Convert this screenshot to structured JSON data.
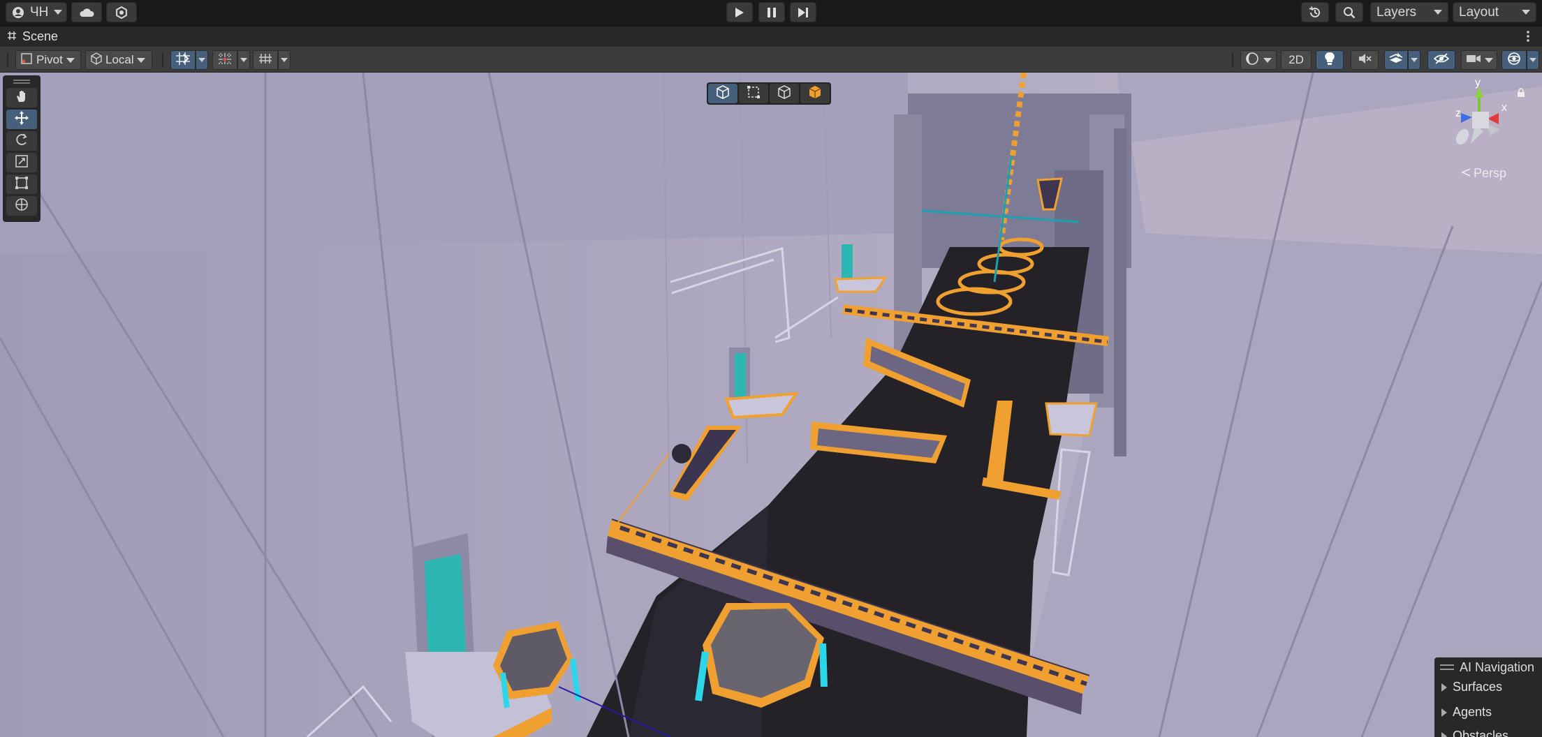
{
  "toolbar": {
    "account_label": "ЧН",
    "layers_label": "Layers",
    "layout_label": "Layout",
    "icons": {
      "account": "account-icon",
      "cloud": "cloud-icon",
      "services": "services-icon",
      "play": "play-icon",
      "pause": "pause-icon",
      "step": "step-icon",
      "history": "history-icon",
      "search": "search-icon"
    }
  },
  "scene_tab": {
    "label": "Scene",
    "icon": "hash-icon",
    "menu_icon": "kebab-menu-icon"
  },
  "scene_toolbar": {
    "pivot_label": "Pivot",
    "local_label": "Local",
    "toggle_2d_label": "2D",
    "icons": [
      "snap-grid-icon",
      "increment-snap-icon",
      "grid-visibility-icon",
      "shading-mode-icon",
      "lighting-icon",
      "audio-mute-icon",
      "effects-icon",
      "hidden-objects-icon",
      "camera-icon",
      "gizmos-icon"
    ]
  },
  "tools": [
    "hand-tool-icon",
    "move-tool-icon",
    "rotate-tool-icon",
    "scale-tool-icon",
    "rect-tool-icon",
    "transform-tool-icon"
  ],
  "active_tool": "move-tool-icon",
  "orientation_buttons": [
    "orientation-cube-icon",
    "rect-orientation-icon",
    "wire-cube-icon",
    "shaded-cube-icon"
  ],
  "gizmo": {
    "x_label": "x",
    "y_label": "y",
    "z_label": "z",
    "projection_label": "Persp",
    "lock_icon": "lock-icon"
  },
  "ai_navigation": {
    "title": "AI Navigation",
    "items": [
      "Surfaces",
      "Agents",
      "Obstacles"
    ]
  },
  "colors": {
    "accent_blue": "#46607c",
    "wall": "#a9a6c0",
    "floor": "#232125",
    "orange": "#f0a030",
    "teal": "#2fbfb8"
  }
}
